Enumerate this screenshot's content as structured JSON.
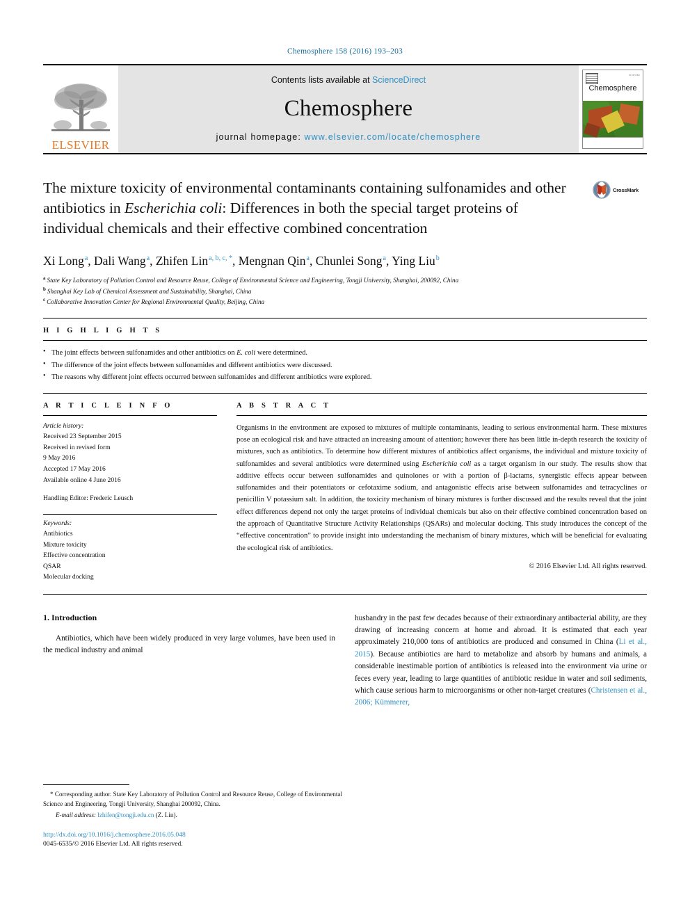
{
  "running_head": "Chemosphere 158 (2016) 193–203",
  "masthead": {
    "contents_prefix": "Contents lists available at ",
    "sciencedirect": "ScienceDirect",
    "journal_name": "Chemosphere",
    "homepage_prefix": "journal homepage: ",
    "homepage_url": "www.elsevier.com/locate/chemosphere",
    "elsevier_wordmark": "ELSEVIER",
    "cover": {
      "title": "Chemosphere",
      "corner_text": "ELSEVIER"
    }
  },
  "title": {
    "line1": "The mixture toxicity of environmental contaminants containing",
    "line2a": "sulfonamides and other antibiotics in ",
    "line2_italic": "Escherichia coli",
    "line2b": ": Differences in",
    "line3": "both the special target proteins of individual chemicals and their",
    "line4": "effective combined concentration",
    "crossmark_label": "CrossMark"
  },
  "authors": {
    "list": [
      {
        "name": "Xi Long",
        "marks": "a"
      },
      {
        "name": "Dali Wang",
        "marks": "a"
      },
      {
        "name": "Zhifen Lin",
        "marks": "a, b, c, *"
      },
      {
        "name": "Mengnan Qin",
        "marks": "a"
      },
      {
        "name": "Chunlei Song",
        "marks": "a"
      },
      {
        "name": "Ying Liu",
        "marks": "b"
      }
    ],
    "affiliations": [
      {
        "mark": "a",
        "text": "State Key Laboratory of Pollution Control and Resource Reuse, College of Environmental Science and Engineering, Tongji University, Shanghai, 200092, China"
      },
      {
        "mark": "b",
        "text": "Shanghai Key Lab of Chemical Assessment and Sustainability, Shanghai, China"
      },
      {
        "mark": "c",
        "text": "Collaborative Innovation Center for Regional Environmental Quality, Beijing, China"
      }
    ]
  },
  "highlights": {
    "label": "H I G H L I G H T S",
    "items": [
      {
        "pre": "The joint effects between sulfonamides and other antibiotics on ",
        "ital": "E. coli",
        "post": " were determined."
      },
      {
        "pre": "The difference of the joint effects between sulfonamides and different antibiotics were discussed.",
        "ital": "",
        "post": ""
      },
      {
        "pre": "The reasons why different joint effects occurred between sulfonamides and different antibiotics were explored.",
        "ital": "",
        "post": ""
      }
    ]
  },
  "article_info": {
    "label": "A R T I C L E   I N F O",
    "history_label": "Article history:",
    "history": [
      "Received 23 September 2015",
      "Received in revised form",
      "9 May 2016",
      "Accepted 17 May 2016",
      "Available online 4 June 2016"
    ],
    "handling_editor": "Handling Editor: Frederic Leusch",
    "keywords_label": "Keywords:",
    "keywords": [
      "Antibiotics",
      "Mixture toxicity",
      "Effective concentration",
      "QSAR",
      "Molecular docking"
    ]
  },
  "abstract": {
    "label": "A B S T R A C T",
    "p1": "Organisms in the environment are exposed to mixtures of multiple contaminants, leading to serious environmental harm. These mixtures pose an ecological risk and have attracted an increasing amount of attention; however there has been little in-depth research the toxicity of mixtures, such as antibiotics. To determine how different mixtures of antibiotics affect organisms, the individual and mixture toxicity of sulfonamides and several antibiotics were determined using ",
    "p1_italic": "Escherichia coli",
    "p2": " as a target organism in our study. The results show that additive effects occur between sulfonamides and quinolones or with a portion of β-lactams, synergistic effects appear between sulfonamides and their potentiators or cefotaxime sodium, and antagonistic effects arise between sulfonamides and tetracyclines or penicillin V potassium salt. In addition, the toxicity mechanism of binary mixtures is further discussed and the results reveal that the joint effect differences depend not only the target proteins of individual chemicals but also on their effective combined concentration based on the approach of Quantitative Structure Activity Relationships (QSARs) and molecular docking. This study introduces the concept of the “effective concentration” to provide insight into understanding the mechanism of binary mixtures, which will be beneficial for evaluating the ecological risk of antibiotics.",
    "copyright": "© 2016 Elsevier Ltd. All rights reserved."
  },
  "introduction": {
    "heading": "1. Introduction",
    "left_par": "Antibiotics, which have been widely produced in very large volumes, have been used in the medical industry and animal",
    "right_par_a": "husbandry in the past few decades because of their extraordinary antibacterial ability, are they drawing of increasing concern at home and abroad. It is estimated that each year approximately 210,000 tons of antibiotics are produced and consumed in China (",
    "right_cite_1": "Li et al., 2015",
    "right_par_b": "). Because antibiotics are hard to metabolize and absorb by humans and animals, a considerable inestimable portion of antibiotics is released into the environment via urine or feces every year, leading to large quantities of antibiotic residue in water and soil sediments, which cause serious harm to microorganisms or other non-target creatures (",
    "right_cite_2": "Christensen et al., 2006; Kümmerer,"
  },
  "footnote": {
    "corresponding": "* Corresponding author. State Key Laboratory of Pollution Control and Resource Reuse, College of Environmental Science and Engineering, Tongji University, Shanghai 200092, China.",
    "email_label": "E-mail address:",
    "email": "lzhifen@tongji.edu.cn",
    "email_suffix": " (Z. Lin).",
    "doi": "http://dx.doi.org/10.1016/j.chemosphere.2016.05.048",
    "issn": "0045-6535/© 2016 Elsevier Ltd. All rights reserved."
  },
  "colors": {
    "link_blue": "#2e8fc4",
    "elsevier_orange": "#E87722",
    "masthead_grey": "#e4e4e4"
  }
}
